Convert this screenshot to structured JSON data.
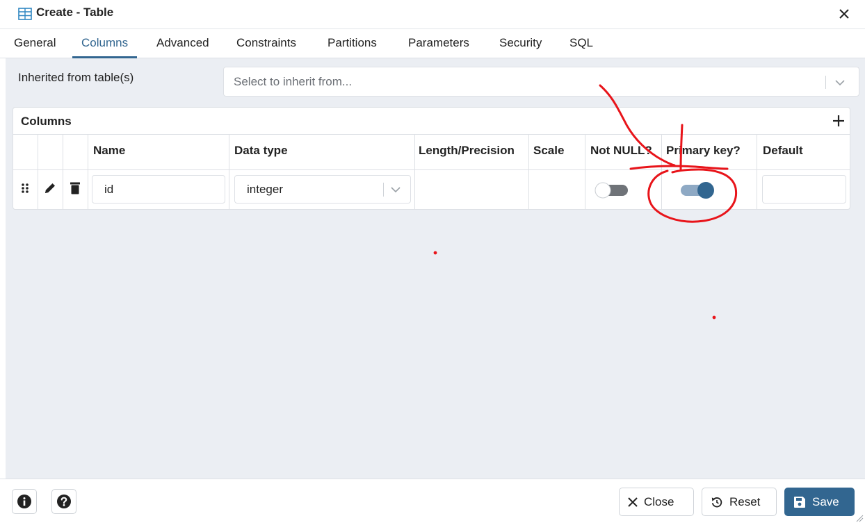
{
  "dialog": {
    "title": "Create - Table",
    "icon": "table-icon",
    "close_icon": "close-icon"
  },
  "tabs": [
    {
      "label": "General",
      "active": false
    },
    {
      "label": "Columns",
      "active": true
    },
    {
      "label": "Advanced",
      "active": false
    },
    {
      "label": "Constraints",
      "active": false
    },
    {
      "label": "Partitions",
      "active": false
    },
    {
      "label": "Parameters",
      "active": false
    },
    {
      "label": "Security",
      "active": false
    },
    {
      "label": "SQL",
      "active": false
    }
  ],
  "inherit": {
    "label": "Inherited from table(s)",
    "placeholder": "Select to inherit from..."
  },
  "columns_grid": {
    "title": "Columns",
    "headers": {
      "name": "Name",
      "data_type": "Data type",
      "length": "Length/Precision",
      "scale": "Scale",
      "not_null": "Not NULL?",
      "primary_key": "Primary key?",
      "default": "Default"
    },
    "rows": [
      {
        "name": "id",
        "data_type": "integer",
        "length": "",
        "scale": "",
        "not_null": false,
        "primary_key": true,
        "default": ""
      }
    ]
  },
  "footer": {
    "close_label": "Close",
    "reset_label": "Reset",
    "save_label": "Save"
  },
  "colors": {
    "accent": "#326690",
    "toggle_on_track": "#8ea9c4",
    "toggle_off_track": "#6f7378",
    "annotation": "#e8141a"
  }
}
